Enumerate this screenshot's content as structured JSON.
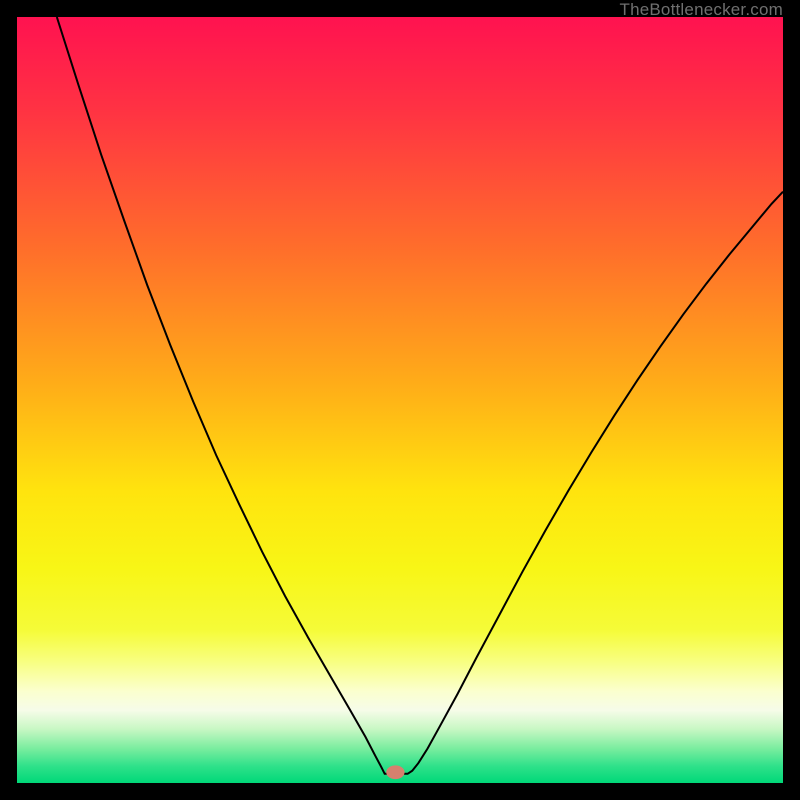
{
  "watermark": "TheBottlenecker.com",
  "chart_data": {
    "type": "line",
    "title": "",
    "xlabel": "",
    "ylabel": "",
    "xlim": [
      0,
      1
    ],
    "ylim": [
      0,
      1
    ],
    "background_gradient": {
      "stops": [
        {
          "offset": 0.0,
          "color": "#ff1250"
        },
        {
          "offset": 0.12,
          "color": "#ff3243"
        },
        {
          "offset": 0.3,
          "color": "#ff6d2b"
        },
        {
          "offset": 0.48,
          "color": "#ffad18"
        },
        {
          "offset": 0.62,
          "color": "#ffe40e"
        },
        {
          "offset": 0.72,
          "color": "#f8f616"
        },
        {
          "offset": 0.8,
          "color": "#f5fb38"
        },
        {
          "offset": 0.84,
          "color": "#f8ff7e"
        },
        {
          "offset": 0.88,
          "color": "#fbffce"
        },
        {
          "offset": 0.905,
          "color": "#f6fce9"
        },
        {
          "offset": 0.93,
          "color": "#c7f7c3"
        },
        {
          "offset": 0.955,
          "color": "#7aed9f"
        },
        {
          "offset": 0.978,
          "color": "#2fe18a"
        },
        {
          "offset": 1.0,
          "color": "#00d878"
        }
      ]
    },
    "marker": {
      "cx": 0.494,
      "cy": 0.986,
      "rx": 0.012,
      "ry": 0.009,
      "fill": "#d6806e"
    },
    "series": [
      {
        "name": "curve",
        "stroke": "#000000",
        "stroke_width": 2,
        "points": [
          [
            0.052,
            0.0
          ],
          [
            0.08,
            0.088
          ],
          [
            0.11,
            0.18
          ],
          [
            0.14,
            0.266
          ],
          [
            0.17,
            0.35
          ],
          [
            0.2,
            0.428
          ],
          [
            0.23,
            0.502
          ],
          [
            0.26,
            0.572
          ],
          [
            0.29,
            0.636
          ],
          [
            0.32,
            0.698
          ],
          [
            0.35,
            0.756
          ],
          [
            0.38,
            0.81
          ],
          [
            0.41,
            0.862
          ],
          [
            0.435,
            0.905
          ],
          [
            0.455,
            0.94
          ],
          [
            0.468,
            0.965
          ],
          [
            0.476,
            0.98
          ],
          [
            0.48,
            0.988
          ],
          [
            0.486,
            0.988
          ],
          [
            0.498,
            0.988
          ],
          [
            0.51,
            0.988
          ],
          [
            0.516,
            0.984
          ],
          [
            0.524,
            0.974
          ],
          [
            0.536,
            0.955
          ],
          [
            0.552,
            0.926
          ],
          [
            0.575,
            0.884
          ],
          [
            0.6,
            0.836
          ],
          [
            0.63,
            0.78
          ],
          [
            0.66,
            0.724
          ],
          [
            0.69,
            0.67
          ],
          [
            0.72,
            0.618
          ],
          [
            0.75,
            0.568
          ],
          [
            0.78,
            0.52
          ],
          [
            0.81,
            0.474
          ],
          [
            0.84,
            0.43
          ],
          [
            0.87,
            0.388
          ],
          [
            0.9,
            0.348
          ],
          [
            0.93,
            0.31
          ],
          [
            0.96,
            0.274
          ],
          [
            0.985,
            0.244
          ],
          [
            1.0,
            0.228
          ]
        ]
      }
    ]
  }
}
